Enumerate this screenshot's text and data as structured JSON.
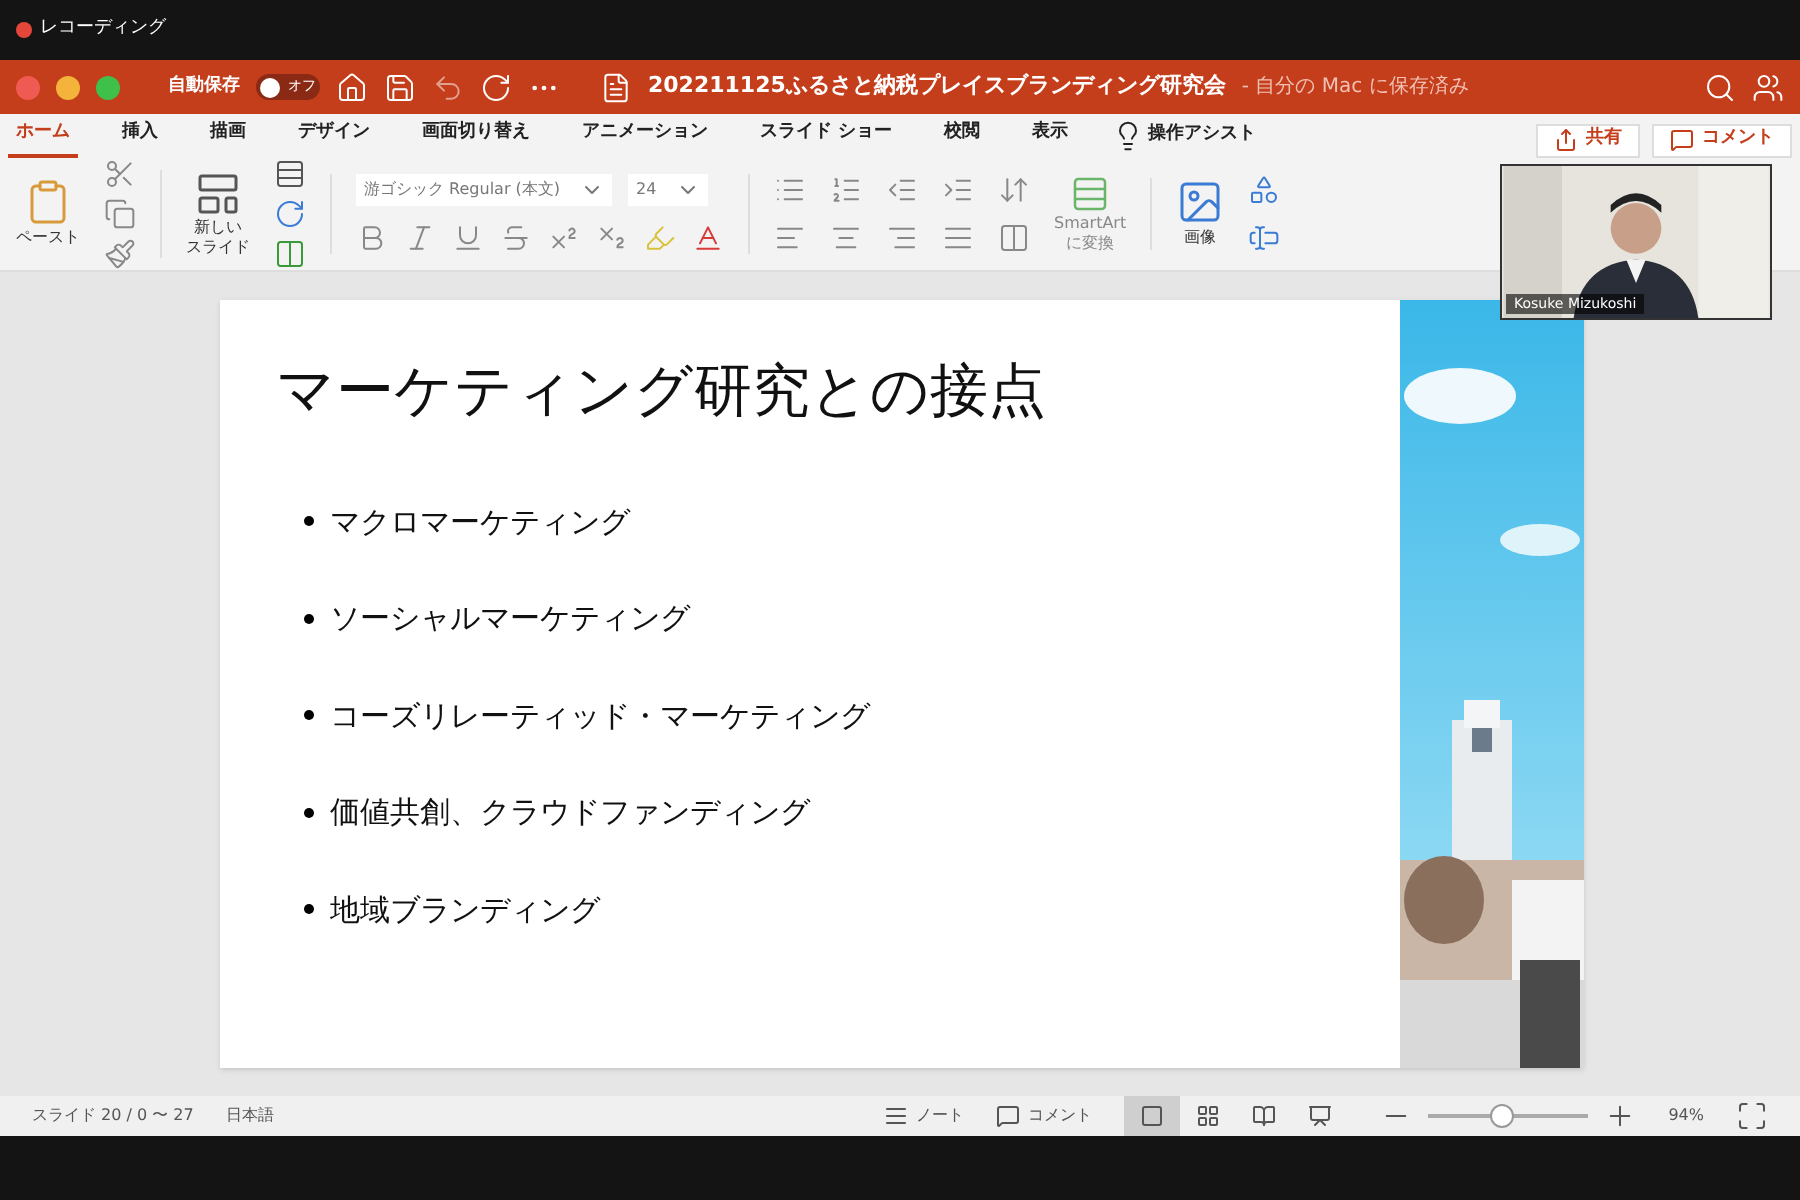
{
  "recording": {
    "label": "レコーディング"
  },
  "title_bar": {
    "autosave_label": "自動保存",
    "autosave_toggle": {
      "label": "オフ",
      "on": false
    },
    "file_name": "202211125ふるさと納税プレイスブランディング研究会",
    "save_status": "- 自分の Mac に保存済み"
  },
  "tabs": [
    {
      "label": "ホーム",
      "selected": true
    },
    {
      "label": "挿入",
      "selected": false
    },
    {
      "label": "描画",
      "selected": false
    },
    {
      "label": "デザイン",
      "selected": false
    },
    {
      "label": "画面切り替え",
      "selected": false
    },
    {
      "label": "アニメーション",
      "selected": false
    },
    {
      "label": "スライド ショー",
      "selected": false
    },
    {
      "label": "校閲",
      "selected": false
    },
    {
      "label": "表示",
      "selected": false
    }
  ],
  "assist": "操作アシスト",
  "share_button": "共有",
  "comment_button": "コメント",
  "ribbon": {
    "paste": "ペースト",
    "new_slide": [
      "新しい",
      "スライド"
    ],
    "font_name": "游ゴシック Regular (本文)",
    "font_size": "24",
    "smartart": "SmartArt\nに変換",
    "picture": "画像"
  },
  "slide": {
    "title": "マーケティング研究との接点",
    "bullets": [
      "マクロマーケティング",
      "ソーシャルマーケティング",
      "コーズリレーティッド・マーケティング",
      "価値共創、クラウドファンディング",
      "地域ブランディング"
    ]
  },
  "video": {
    "name": "Kosuke Mizukoshi"
  },
  "status_bar": {
    "slide_info": "スライド 20 / 0 〜 27",
    "language": "日本語",
    "notes": "ノート",
    "comments": "コメント",
    "views": [
      {
        "kind": "normal",
        "selected": true
      },
      {
        "kind": "sorter",
        "selected": false
      },
      {
        "kind": "reading",
        "selected": false
      },
      {
        "kind": "show",
        "selected": false
      }
    ],
    "zoom": {
      "level": 0.45,
      "reading": "94%"
    }
  }
}
